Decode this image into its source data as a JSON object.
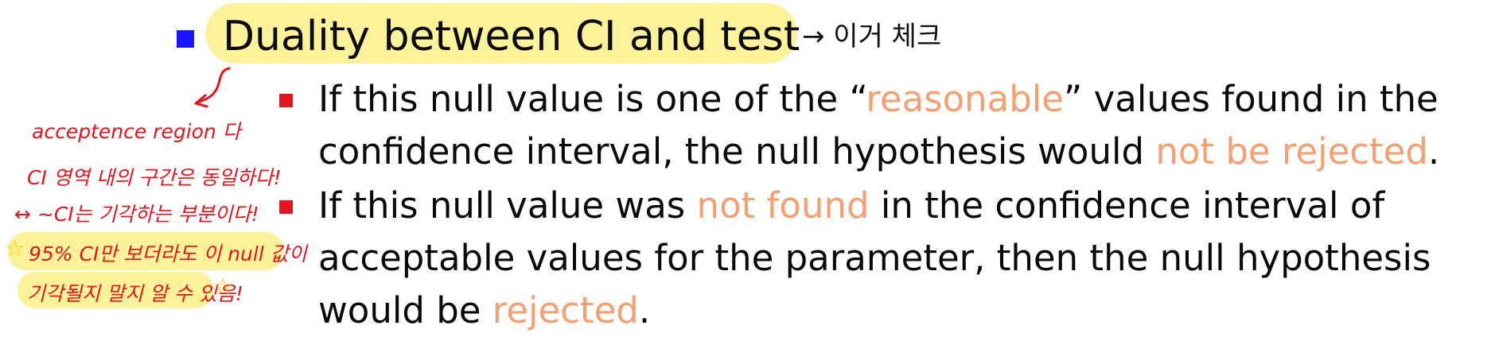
{
  "heading": {
    "text": "Duality between CI and test",
    "annotation": "→ 이거 체크"
  },
  "bullets": [
    {
      "line1": {
        "before": "If this null value is one of the “",
        "accent": "reasonable",
        "after": "” values found in the"
      },
      "line2": {
        "before": "confidence interval, the null hypothesis would ",
        "accent": "not be rejected",
        "after": "."
      }
    },
    {
      "line1": {
        "before": "If this null value was ",
        "accent": "not found",
        "after": " in the confidence interval of"
      },
      "line2": {
        "text": "acceptable values for the parameter, then the null hypothesis"
      },
      "line3": {
        "before": "would be ",
        "accent": "rejected",
        "after": "."
      }
    }
  ],
  "margin_notes": [
    "acceptence region 다",
    "CI 영역 내의 구간은 동일하다!",
    "↔ ~CI는 기각하는 부분이다!",
    "95% CI만 보더라도 이 null 값이",
    "기각될지 말지 알 수 있음!"
  ],
  "colors": {
    "accent": "#f4a070",
    "highlight": "#fbf29a",
    "heading_bullet": "#1515ff",
    "sub_bullet": "#e8141c",
    "handwriting": "#e8141c"
  }
}
